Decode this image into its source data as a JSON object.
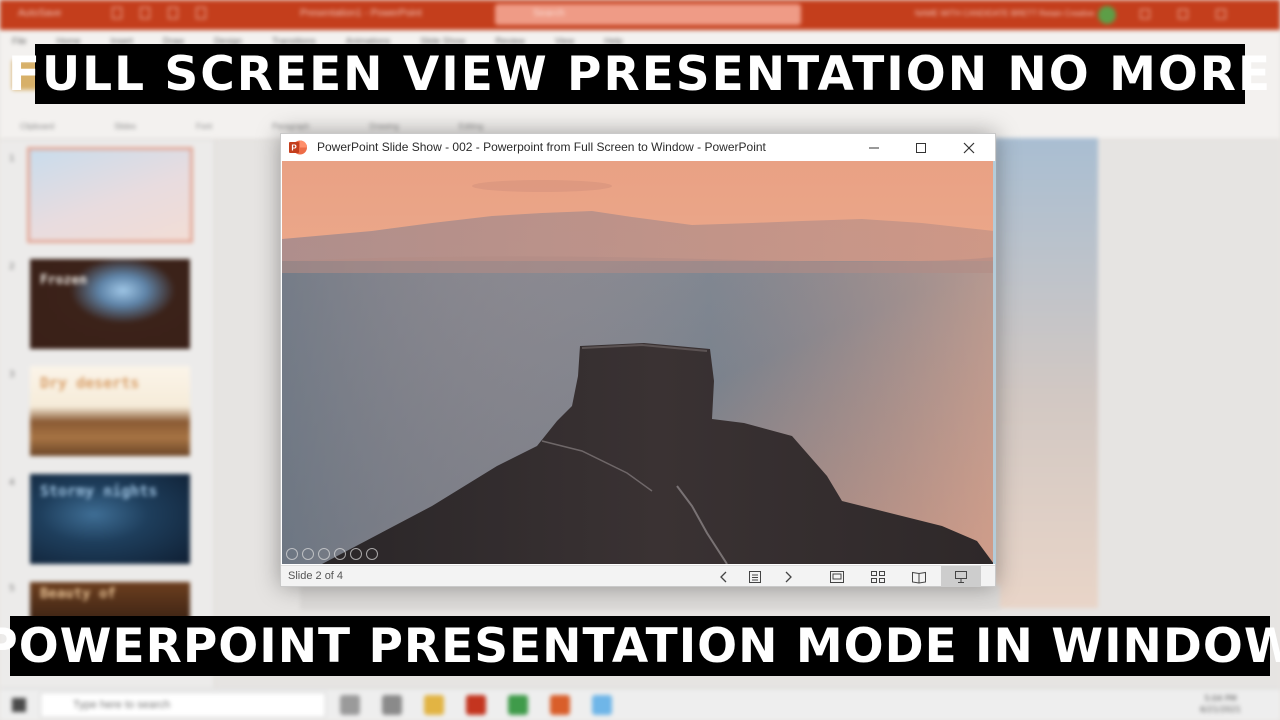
{
  "background": {
    "quick_access_label": "AutoSave",
    "document_title": "Presentation1 - PowerPoint",
    "search_placeholder": "Search",
    "user_label": "NAME WITH CANDIDATE BRETT Retain Creative",
    "ribbon_tabs": [
      "File",
      "Home",
      "Insert",
      "Draw",
      "Design",
      "Transitions",
      "Animations",
      "Slide Show",
      "Review",
      "View",
      "Help"
    ],
    "ribbon_groups": [
      "Clipboard",
      "Slides",
      "Font",
      "Paragraph",
      "Drawing",
      "Editing"
    ],
    "slide_numbers": [
      "1",
      "2",
      "3",
      "4",
      "5"
    ],
    "thumbnail_titles": [
      "",
      "Frozen",
      "Dry deserts",
      "Stormy nights",
      "Beauty of"
    ],
    "taskbar_search_placeholder": "Type here to search",
    "clock_time": "5:04 PM",
    "clock_date": "6/21/2021"
  },
  "slideshow_window": {
    "title": "PowerPoint Slide Show  -  002 - Powerpoint from Full Screen to Window - PowerPoint",
    "status_text": "Slide 2 of 4",
    "active_view": "slide-show"
  },
  "banners": {
    "top": "FULL SCREEN VIEW PRESENTATION NO MORE",
    "bottom": "POWERPOINT PRESENTATION MODE IN WINDOW"
  },
  "colors": {
    "ppt_orange": "#c43e1c",
    "banner_bg": "#000000",
    "banner_text": "#ffffff"
  }
}
